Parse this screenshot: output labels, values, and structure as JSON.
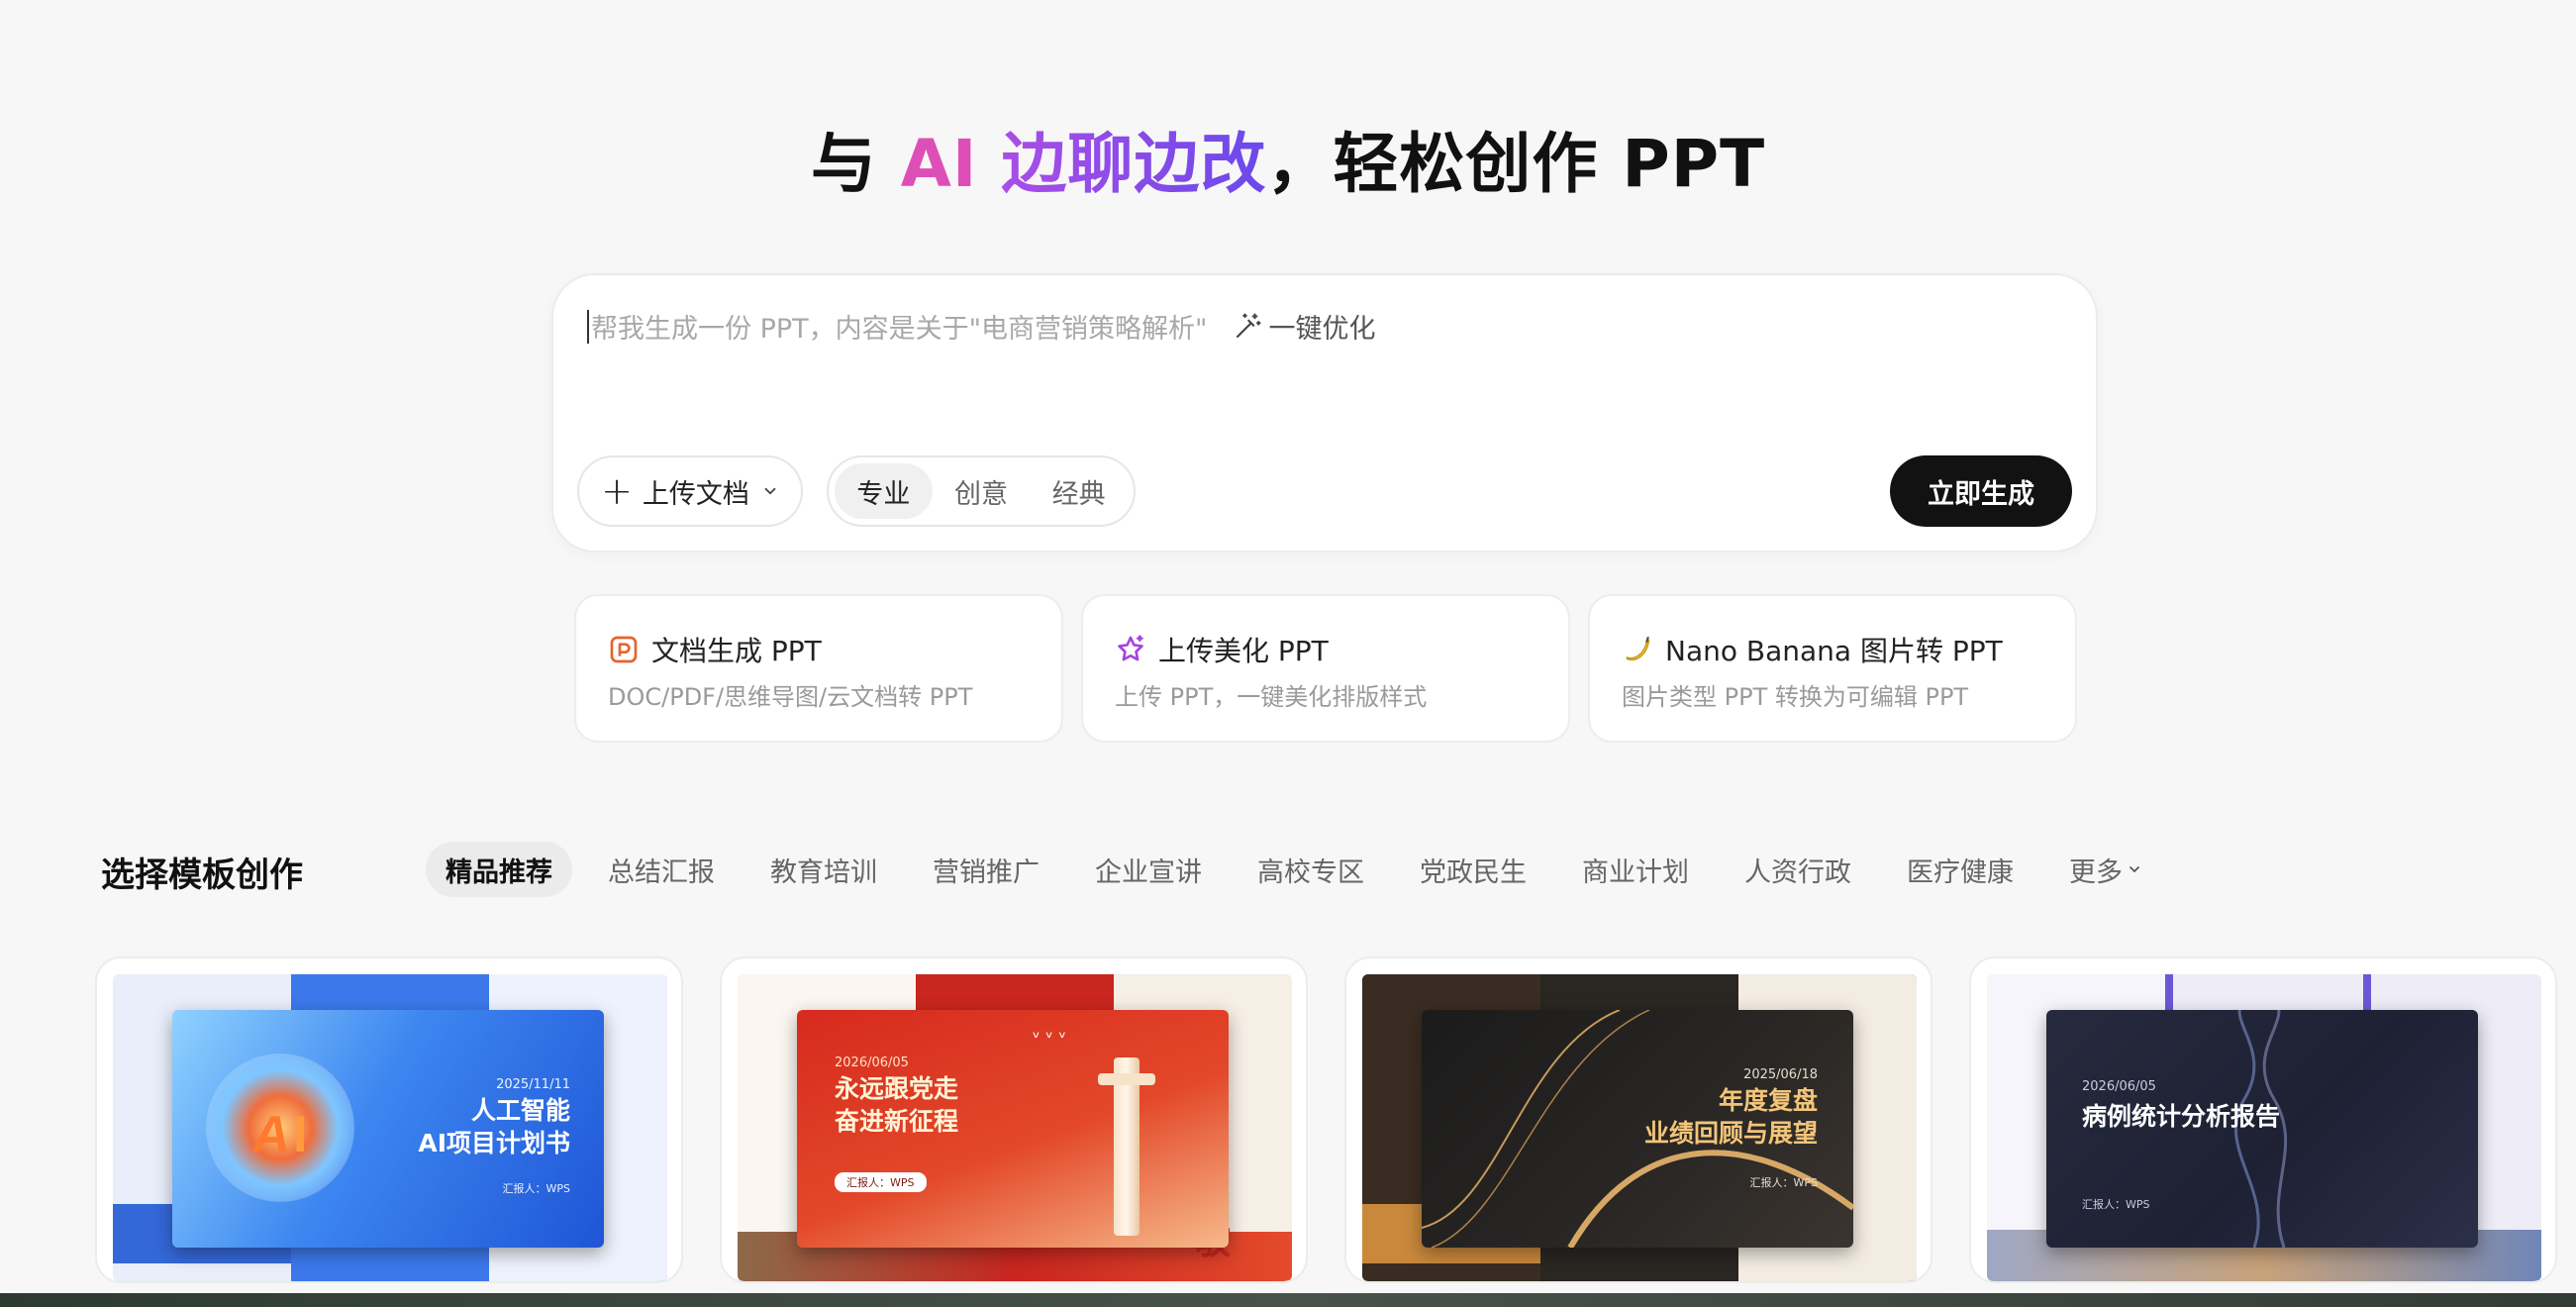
{
  "hero": {
    "prefix": "与 ",
    "ai": "AI",
    "highlight": " 边聊边改",
    "suffix": "，轻松创作 PPT"
  },
  "prompt": {
    "placeholder": "帮我生成一份 PPT，内容是关于\"电商营销策略解析\"",
    "optimize_label": "一键优化",
    "upload_label": "上传文档",
    "styles": [
      "专业",
      "创意",
      "经典"
    ],
    "active_style": "专业",
    "generate_label": "立即生成"
  },
  "features": [
    {
      "title": "文档生成 PPT",
      "subtitle": "DOC/PDF/思维导图/云文档转 PPT",
      "icon": "document-ppt-icon",
      "color": "#e8632c"
    },
    {
      "title": "上传美化 PPT",
      "subtitle": "上传 PPT，一键美化排版样式",
      "icon": "sparkle-star-icon",
      "color": "#a544e0"
    },
    {
      "title": "Nano Banana 图片转 PPT",
      "subtitle": "图片类型 PPT 转换为可编辑 PPT",
      "icon": "banana-icon",
      "color": "#f2c230"
    }
  ],
  "templates": {
    "section_title": "选择模板创作",
    "categories": [
      "精品推荐",
      "总结汇报",
      "教育培训",
      "营销推广",
      "企业宣讲",
      "高校专区",
      "党政民生",
      "商业计划",
      "人资行政",
      "医疗健康"
    ],
    "active_category": "精品推荐",
    "more_label": "更多",
    "cards": [
      {
        "date": "2025/11/11",
        "title_line1": "人工智能",
        "title_line2": "AI项目计划书",
        "reporter": "汇报人：WPS",
        "theme": "blue"
      },
      {
        "date": "2026/06/05",
        "title_line1": "永远跟党走",
        "title_line2": "奋进新征程",
        "reporter": "汇报人：WPS",
        "theme": "red"
      },
      {
        "date": "2025/06/18",
        "title_line1": "年度复盘",
        "title_line2": "业绩回顾与展望",
        "reporter": "汇报人：WPS",
        "theme": "gold"
      },
      {
        "date": "2026/06/05",
        "title_line1": "病例统计分析报告",
        "title_line2": "",
        "reporter": "汇报人：WPS",
        "theme": "navy"
      }
    ]
  },
  "colors": {
    "ai_pink": "#dd4fb6",
    "gradient_start": "#b04ee6",
    "gradient_end": "#6a49ea",
    "primary_button": "#121212"
  }
}
